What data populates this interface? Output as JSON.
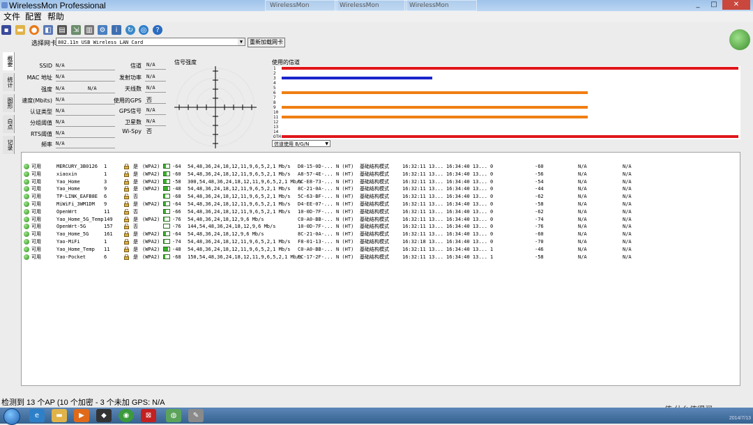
{
  "window": {
    "title": "WirelessMon Professional",
    "ghost_tabs": [
      "WirelessMon",
      "WirelessMon",
      "WirelessMon"
    ]
  },
  "menu": [
    "文件",
    "配置",
    "帮助"
  ],
  "adapter": {
    "label": "选择网卡",
    "value": "802.11n USB Wireless LAN Card",
    "reload": "重新加载网卡"
  },
  "sidebar_tabs": [
    "概要",
    "统计",
    "图形",
    "白点",
    "记录"
  ],
  "info": {
    "left": [
      {
        "label": "SSID",
        "value": "N/A"
      },
      {
        "label": "MAC 地址",
        "value": "N/A"
      },
      {
        "label": "强度",
        "value": "N/A",
        "value2": "N/A"
      },
      {
        "label": "速度(Mbits)",
        "value": "N/A"
      },
      {
        "label": "认证类型",
        "value": "N/A"
      },
      {
        "label": "分组阈值",
        "value": "N/A"
      },
      {
        "label": "RTS阈值",
        "value": "N/A"
      },
      {
        "label": "频率",
        "value": "N/A"
      }
    ],
    "right": [
      {
        "label": "信道",
        "value": "N/A"
      },
      {
        "label": "发射功率",
        "value": "N/A"
      },
      {
        "label": "天线数",
        "value": "N/A"
      },
      {
        "label": "使用的GPS",
        "value": "否"
      },
      {
        "label": "GPS信号",
        "value": "N/A"
      },
      {
        "label": "卫星数",
        "value": "N/A"
      },
      {
        "label": "Wi-Spy",
        "value": "否"
      }
    ]
  },
  "signal": {
    "label": "信号强度"
  },
  "channels": {
    "label": "使用的信道",
    "numbers": [
      "1",
      "2",
      "3",
      "4",
      "5",
      "6",
      "7",
      "8",
      "9",
      "10",
      "11",
      "12",
      "13",
      "14",
      "OTH"
    ],
    "bars": [
      {
        "channel": "1",
        "fraction": 1.0,
        "color": "#e0161b"
      },
      {
        "channel": "3",
        "fraction": 0.33,
        "color": "#1a25cc"
      },
      {
        "channel": "6",
        "fraction": 0.67,
        "color": "#f07f12"
      },
      {
        "channel": "9",
        "fraction": 0.67,
        "color": "#f07f12"
      },
      {
        "channel": "11",
        "fraction": 0.67,
        "color": "#f07f12"
      },
      {
        "channel": "OTH",
        "fraction": 1.0,
        "color": "#e0161b"
      }
    ],
    "select": "信道使用 B/G/N"
  },
  "ap_rows": [
    {
      "status": "可用",
      "ssid": "MERCURY_3B0126",
      "channel": "1",
      "secure": "是",
      "enc": "(WPA2)",
      "rssi": "-64",
      "rates": "54,48,36,24,18,12,11,9,6,5,2,1 Mb/s",
      "mac": "D8-15-0D-...",
      "mode": "N (HT)",
      "type": "基础结构模式",
      "first": "16:32:11 13...",
      "last": "16:34:40 13...",
      "c1": "0",
      "max": "-60",
      "n1": "N/A",
      "n2": "N/A",
      "sig": 0.4
    },
    {
      "status": "可用",
      "ssid": "xiaoxin",
      "channel": "1",
      "secure": "是",
      "enc": "(WPA2)",
      "rssi": "-60",
      "rates": "54,48,36,24,18,12,11,9,6,5,2,1 Mb/s",
      "mac": "A8-57-4E-...",
      "mode": "N (HT)",
      "type": "基础结构模式",
      "first": "16:32:11 13...",
      "last": "16:34:40 13...",
      "c1": "0",
      "max": "-56",
      "n1": "N/A",
      "n2": "N/A",
      "sig": 0.5
    },
    {
      "status": "可用",
      "ssid": "Yao_Home",
      "channel": "3",
      "secure": "是",
      "enc": "(WPA2)",
      "rssi": "-58",
      "rates": "300,54,48,36,24,18,12,11,9,6,5,2,1 Mb/s",
      "mac": "6C-E8-73-...",
      "mode": "N (HT)",
      "type": "基础结构模式",
      "first": "16:32:11 13...",
      "last": "16:34:40 13...",
      "c1": "0",
      "max": "-54",
      "n1": "N/A",
      "n2": "N/A",
      "sig": 0.55
    },
    {
      "status": "可用",
      "ssid": "Yao_Home",
      "channel": "9",
      "secure": "是",
      "enc": "(WPA2)",
      "rssi": "-48",
      "rates": "54,48,36,24,18,12,11,9,6,5,2,1 Mb/s",
      "mac": "8C-21-0A-...",
      "mode": "N (HT)",
      "type": "基础结构模式",
      "first": "16:32:11 13...",
      "last": "16:34:40 13...",
      "c1": "0",
      "max": "-44",
      "n1": "N/A",
      "n2": "N/A",
      "sig": 0.75
    },
    {
      "status": "可用",
      "ssid": "TP-LINK_EAFB8E",
      "channel": "6",
      "secure": "否",
      "enc": "",
      "rssi": "-68",
      "rates": "54,48,36,24,18,12,11,9,6,5,2,1 Mb/s",
      "mac": "5C-63-BF-...",
      "mode": "N (HT)",
      "type": "基础结构模式",
      "first": "16:32:11 13...",
      "last": "16:34:40 13...",
      "c1": "0",
      "max": "-62",
      "n1": "N/A",
      "n2": "N/A",
      "sig": 0.3
    },
    {
      "status": "可用",
      "ssid": "MiWiFi_3WM1DM",
      "channel": "9",
      "secure": "是",
      "enc": "(WPA2)",
      "rssi": "-64",
      "rates": "54,48,36,24,18,12,11,9,6,5,2,1 Mb/s",
      "mac": "D4-EE-07-...",
      "mode": "N (HT)",
      "type": "基础结构模式",
      "first": "16:32:11 13...",
      "last": "16:34:40 13...",
      "c1": "0",
      "max": "-58",
      "n1": "N/A",
      "n2": "N/A",
      "sig": 0.4
    },
    {
      "status": "可用",
      "ssid": "OpenWrt",
      "channel": "11",
      "secure": "否",
      "enc": "",
      "rssi": "-66",
      "rates": "54,48,36,24,18,12,11,9,6,5,2,1 Mb/s",
      "mac": "10-0D-7F-...",
      "mode": "N (HT)",
      "type": "基础结构模式",
      "first": "16:32:11 13...",
      "last": "16:34:40 13...",
      "c1": "0",
      "max": "-62",
      "n1": "N/A",
      "n2": "N/A",
      "sig": 0.35
    },
    {
      "status": "可用",
      "ssid": "Yao_Home_5G_Temp",
      "channel": "149",
      "secure": "是",
      "enc": "(WPA2)",
      "rssi": "-76",
      "rates": "54,48,36,24,18,12,9,6 Mb/s",
      "mac": "C0-A0-BB-...",
      "mode": "N (HT)",
      "type": "基础结构模式",
      "first": "16:32:11 13...",
      "last": "16:34:40 13...",
      "c1": "0",
      "max": "-74",
      "n1": "N/A",
      "n2": "N/A",
      "sig": 0.1
    },
    {
      "status": "可用",
      "ssid": "OpenWrt-5G",
      "channel": "157",
      "secure": "否",
      "enc": "",
      "rssi": "-76",
      "rates": "144,54,48,36,24,18,12,9,6 Mb/s",
      "mac": "10-0D-7F-...",
      "mode": "N (HT)",
      "type": "基础结构模式",
      "first": "16:32:11 13...",
      "last": "16:34:40 13...",
      "c1": "0",
      "max": "-76",
      "n1": "N/A",
      "n2": "N/A",
      "sig": 0.0
    },
    {
      "status": "可用",
      "ssid": "Yao_Home_5G",
      "channel": "161",
      "secure": "是",
      "enc": "(WPA2)",
      "rssi": "-64",
      "rates": "54,48,36,24,18,12,9,6 Mb/s",
      "mac": "8C-21-0A-...",
      "mode": "N (HT)",
      "type": "基础结构模式",
      "first": "16:32:11 13...",
      "last": "16:34:40 13...",
      "c1": "0",
      "max": "-60",
      "n1": "N/A",
      "n2": "N/A",
      "sig": 0.4
    },
    {
      "status": "可用",
      "ssid": "Yao-MiFi",
      "channel": "1",
      "secure": "是",
      "enc": "(WPA2)",
      "rssi": "-74",
      "rates": "54,48,36,24,18,12,11,9,6,5,2,1 Mb/s",
      "mac": "F8-01-13-...",
      "mode": "N (HT)",
      "type": "基础结构模式",
      "first": "16:32:18 13...",
      "last": "16:34:40 13...",
      "c1": "0",
      "max": "-70",
      "n1": "N/A",
      "n2": "N/A",
      "sig": 0.15
    },
    {
      "status": "可用",
      "ssid": "Yao_Home_Temp",
      "channel": "11",
      "secure": "是",
      "enc": "(WPA2)",
      "rssi": "-48",
      "rates": "54,48,36,24,18,12,11,9,6,5,2,1 Mb/s",
      "mac": "C0-A0-BB-...",
      "mode": "N (HT)",
      "type": "基础结构模式",
      "first": "16:32:11 13...",
      "last": "16:34:40 13...",
      "c1": "1",
      "max": "-46",
      "n1": "N/A",
      "n2": "N/A",
      "sig": 0.75
    },
    {
      "status": "可用",
      "ssid": "Yao-Pocket",
      "channel": "6",
      "secure": "是",
      "enc": "(WPA2)",
      "rssi": "-68",
      "rates": "150,54,48,36,24,18,12,11,9,6,5,2,1 Mb/s",
      "mac": "EC-17-2F-...",
      "mode": "N (HT)",
      "type": "基础结构模式",
      "first": "16:32:11 13...",
      "last": "16:34:40 13...",
      "c1": "1",
      "max": "-58",
      "n1": "N/A",
      "n2": "N/A",
      "sig": 0.3
    }
  ],
  "status_bar": "检测到 13 个AP (10 个加密 - 3 个未加 GPS: N/A",
  "watermark": "值 什么值得买",
  "clock": "2014/7/13"
}
